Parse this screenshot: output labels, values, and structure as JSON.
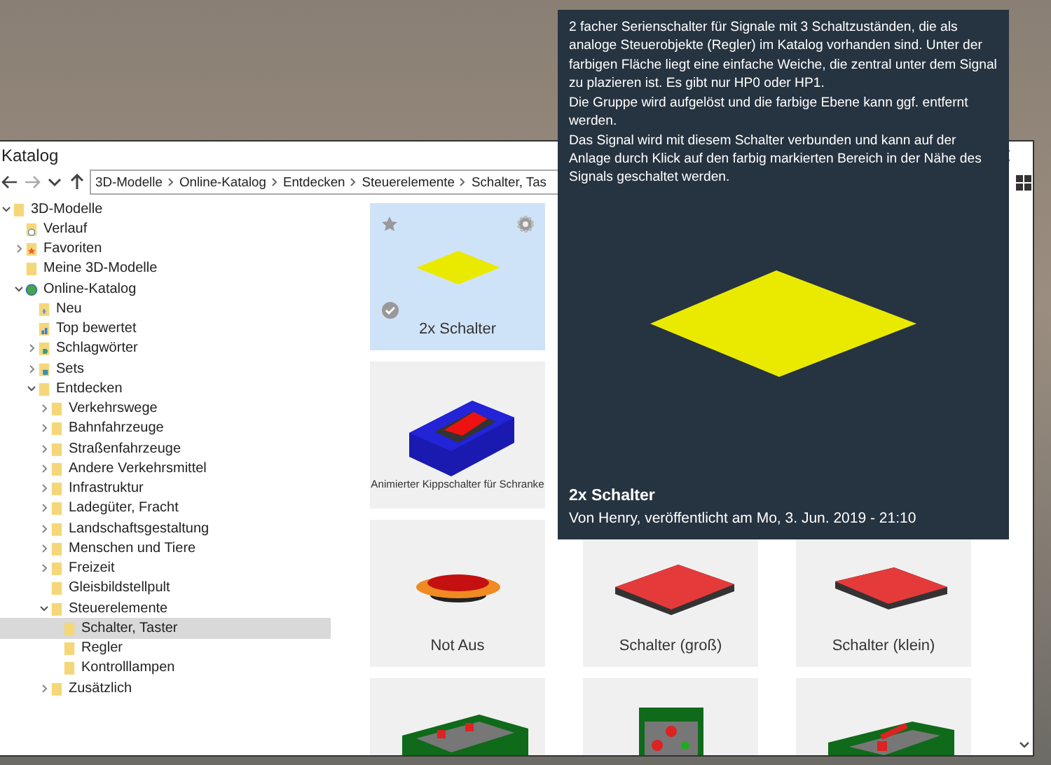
{
  "window": {
    "title": "Katalog"
  },
  "toolbar": {
    "breadcrumb": [
      "3D-Modelle",
      "Online-Katalog",
      "Entdecken",
      "Steuerelemente",
      "Schalter, Tas"
    ]
  },
  "tree": [
    {
      "label": "3D-Modelle",
      "kind": "folder",
      "expanded": true,
      "selected": false,
      "children": [
        {
          "label": "Verlauf",
          "kind": "history",
          "selected": false
        },
        {
          "label": "Favoriten",
          "kind": "favorites",
          "expanded": false,
          "selected": false
        },
        {
          "label": "Meine 3D-Modelle",
          "kind": "folder",
          "selected": false
        },
        {
          "label": "Online-Katalog",
          "kind": "globe",
          "expanded": true,
          "selected": false,
          "children": [
            {
              "label": "Neu",
              "kind": "new",
              "selected": false
            },
            {
              "label": "Top bewertet",
              "kind": "rated",
              "selected": false
            },
            {
              "label": "Schlagwörter",
              "kind": "tags",
              "expanded": false,
              "selected": false
            },
            {
              "label": "Sets",
              "kind": "sets",
              "expanded": false,
              "selected": false
            },
            {
              "label": "Entdecken",
              "kind": "folder",
              "expanded": true,
              "selected": false,
              "children": [
                {
                  "label": "Verkehrswege",
                  "kind": "folder",
                  "expanded": false,
                  "selected": false
                },
                {
                  "label": "Bahnfahrzeuge",
                  "kind": "folder",
                  "expanded": false,
                  "selected": false
                },
                {
                  "label": "Straßenfahrzeuge",
                  "kind": "folder",
                  "expanded": false,
                  "selected": false
                },
                {
                  "label": "Andere Verkehrsmittel",
                  "kind": "folder",
                  "expanded": false,
                  "selected": false
                },
                {
                  "label": "Infrastruktur",
                  "kind": "folder",
                  "expanded": false,
                  "selected": false
                },
                {
                  "label": "Ladegüter, Fracht",
                  "kind": "folder",
                  "expanded": false,
                  "selected": false
                },
                {
                  "label": "Landschaftsgestaltung",
                  "kind": "folder",
                  "expanded": false,
                  "selected": false
                },
                {
                  "label": "Menschen und Tiere",
                  "kind": "folder",
                  "expanded": false,
                  "selected": false
                },
                {
                  "label": "Freizeit",
                  "kind": "folder",
                  "expanded": false,
                  "selected": false
                },
                {
                  "label": "Gleisbildstellpult",
                  "kind": "folder",
                  "selected": false
                },
                {
                  "label": "Steuerelemente",
                  "kind": "folder",
                  "expanded": true,
                  "selected": false,
                  "children": [
                    {
                      "label": "Schalter, Taster",
                      "kind": "folder",
                      "selected": true
                    },
                    {
                      "label": "Regler",
                      "kind": "folder",
                      "selected": false
                    },
                    {
                      "label": "Kontrolllampen",
                      "kind": "folder",
                      "selected": false
                    }
                  ]
                },
                {
                  "label": "Zusätzlich",
                  "kind": "folder",
                  "expanded": false,
                  "selected": false
                }
              ]
            }
          ]
        }
      ]
    }
  ],
  "grid_rows": [
    [
      {
        "title": "2x Schalter",
        "kind": "plate",
        "selected": true
      }
    ],
    [
      {
        "title": "Animierter Kippschalter für Schranke",
        "kind": "toggle",
        "selected": false
      }
    ],
    [
      {
        "title": "Not Aus",
        "kind": "emergency-stop",
        "selected": false
      },
      {
        "title": "Schalter (groß)",
        "kind": "switch-large",
        "selected": false
      },
      {
        "title": "Schalter (klein)",
        "kind": "switch-small",
        "selected": false
      }
    ],
    [
      {
        "kind": "panel-box",
        "selected": false
      },
      {
        "kind": "panel-front",
        "selected": false
      },
      {
        "kind": "panel-lever",
        "selected": false
      }
    ]
  ],
  "tooltip": {
    "paragraphs": [
      "2 facher Serienschalter für Signale mit 3 Schaltzuständen, die als analoge Steuerobjekte (Regler) im Katalog vorhanden sind. Unter der farbigen Fläche liegt eine einfache Weiche, die zentral unter dem Signal zu plazieren ist. Es gibt nur HP0 oder HP1.",
      "Die Gruppe wird aufgelöst und die farbige Ebene kann ggf. entfernt werden.",
      "Das Signal wird mit diesem Schalter verbunden und kann auf der Anlage durch Klick auf den farbig markierten Bereich in der Nähe des Signals geschaltet werden."
    ],
    "title": "2x Schalter",
    "byline": "Von Henry, veröffentlicht am Mo, 3. Jun. 2019 - 21:10"
  }
}
